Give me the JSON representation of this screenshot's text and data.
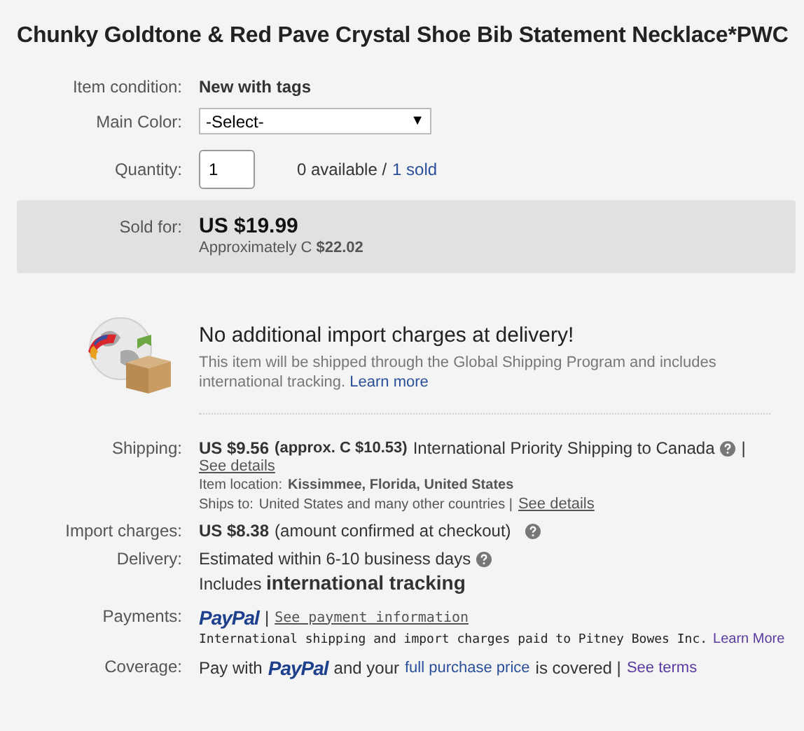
{
  "title": "Chunky Goldtone & Red Pave Crystal Shoe Bib Statement Necklace*PWC",
  "condition": {
    "label": "Item condition:",
    "value": "New with tags"
  },
  "main_color": {
    "label": "Main Color:",
    "value": "-Select-",
    "caret": "▼"
  },
  "quantity": {
    "label": "Quantity:",
    "value": "1",
    "available": "0 available /",
    "sold_link": "1 sold"
  },
  "sold_for": {
    "label": "Sold for:",
    "price": "US $19.99",
    "approx": "Approximately C **$22.02**"
  },
  "gsp": {
    "heading": "No additional import charges at delivery!",
    "text": "This item will be shipped through the Global Shipping Program and includes international tracking.",
    "link": "Learn more"
  },
  "shipping": {
    "label": "Shipping:",
    "price": "US $9.56",
    "approx": "(approx. C $10.53)",
    "service": "International Priority Shipping to Canada",
    "separator": "|",
    "details_link": "See details",
    "location_label": "Item location:",
    "location": "Kissimmee, Florida, United States",
    "ships_to_label": "Ships to:",
    "ships_to": "United States and many other countries |",
    "ships_to_link": "See details"
  },
  "import_charges": {
    "label": "Import charges:",
    "price": "US $8.38",
    "note": "(amount confirmed at checkout)"
  },
  "delivery": {
    "label": "Delivery:",
    "estimate": "Estimated within 6-10 business days",
    "tracking": "Includes **international tracking**"
  },
  "payments": {
    "label": "Payments:",
    "logo": "PayPal",
    "separator": "|",
    "link": "See payment information",
    "note": "International shipping and import charges paid to Pitney Bowes Inc.",
    "note_link": "Learn More"
  },
  "coverage": {
    "label": "Coverage:",
    "before": "Pay with",
    "logo": "PayPal",
    "middle": "and your",
    "link": "full purchase price",
    "after": "is covered |",
    "terms_link": "See terms"
  }
}
